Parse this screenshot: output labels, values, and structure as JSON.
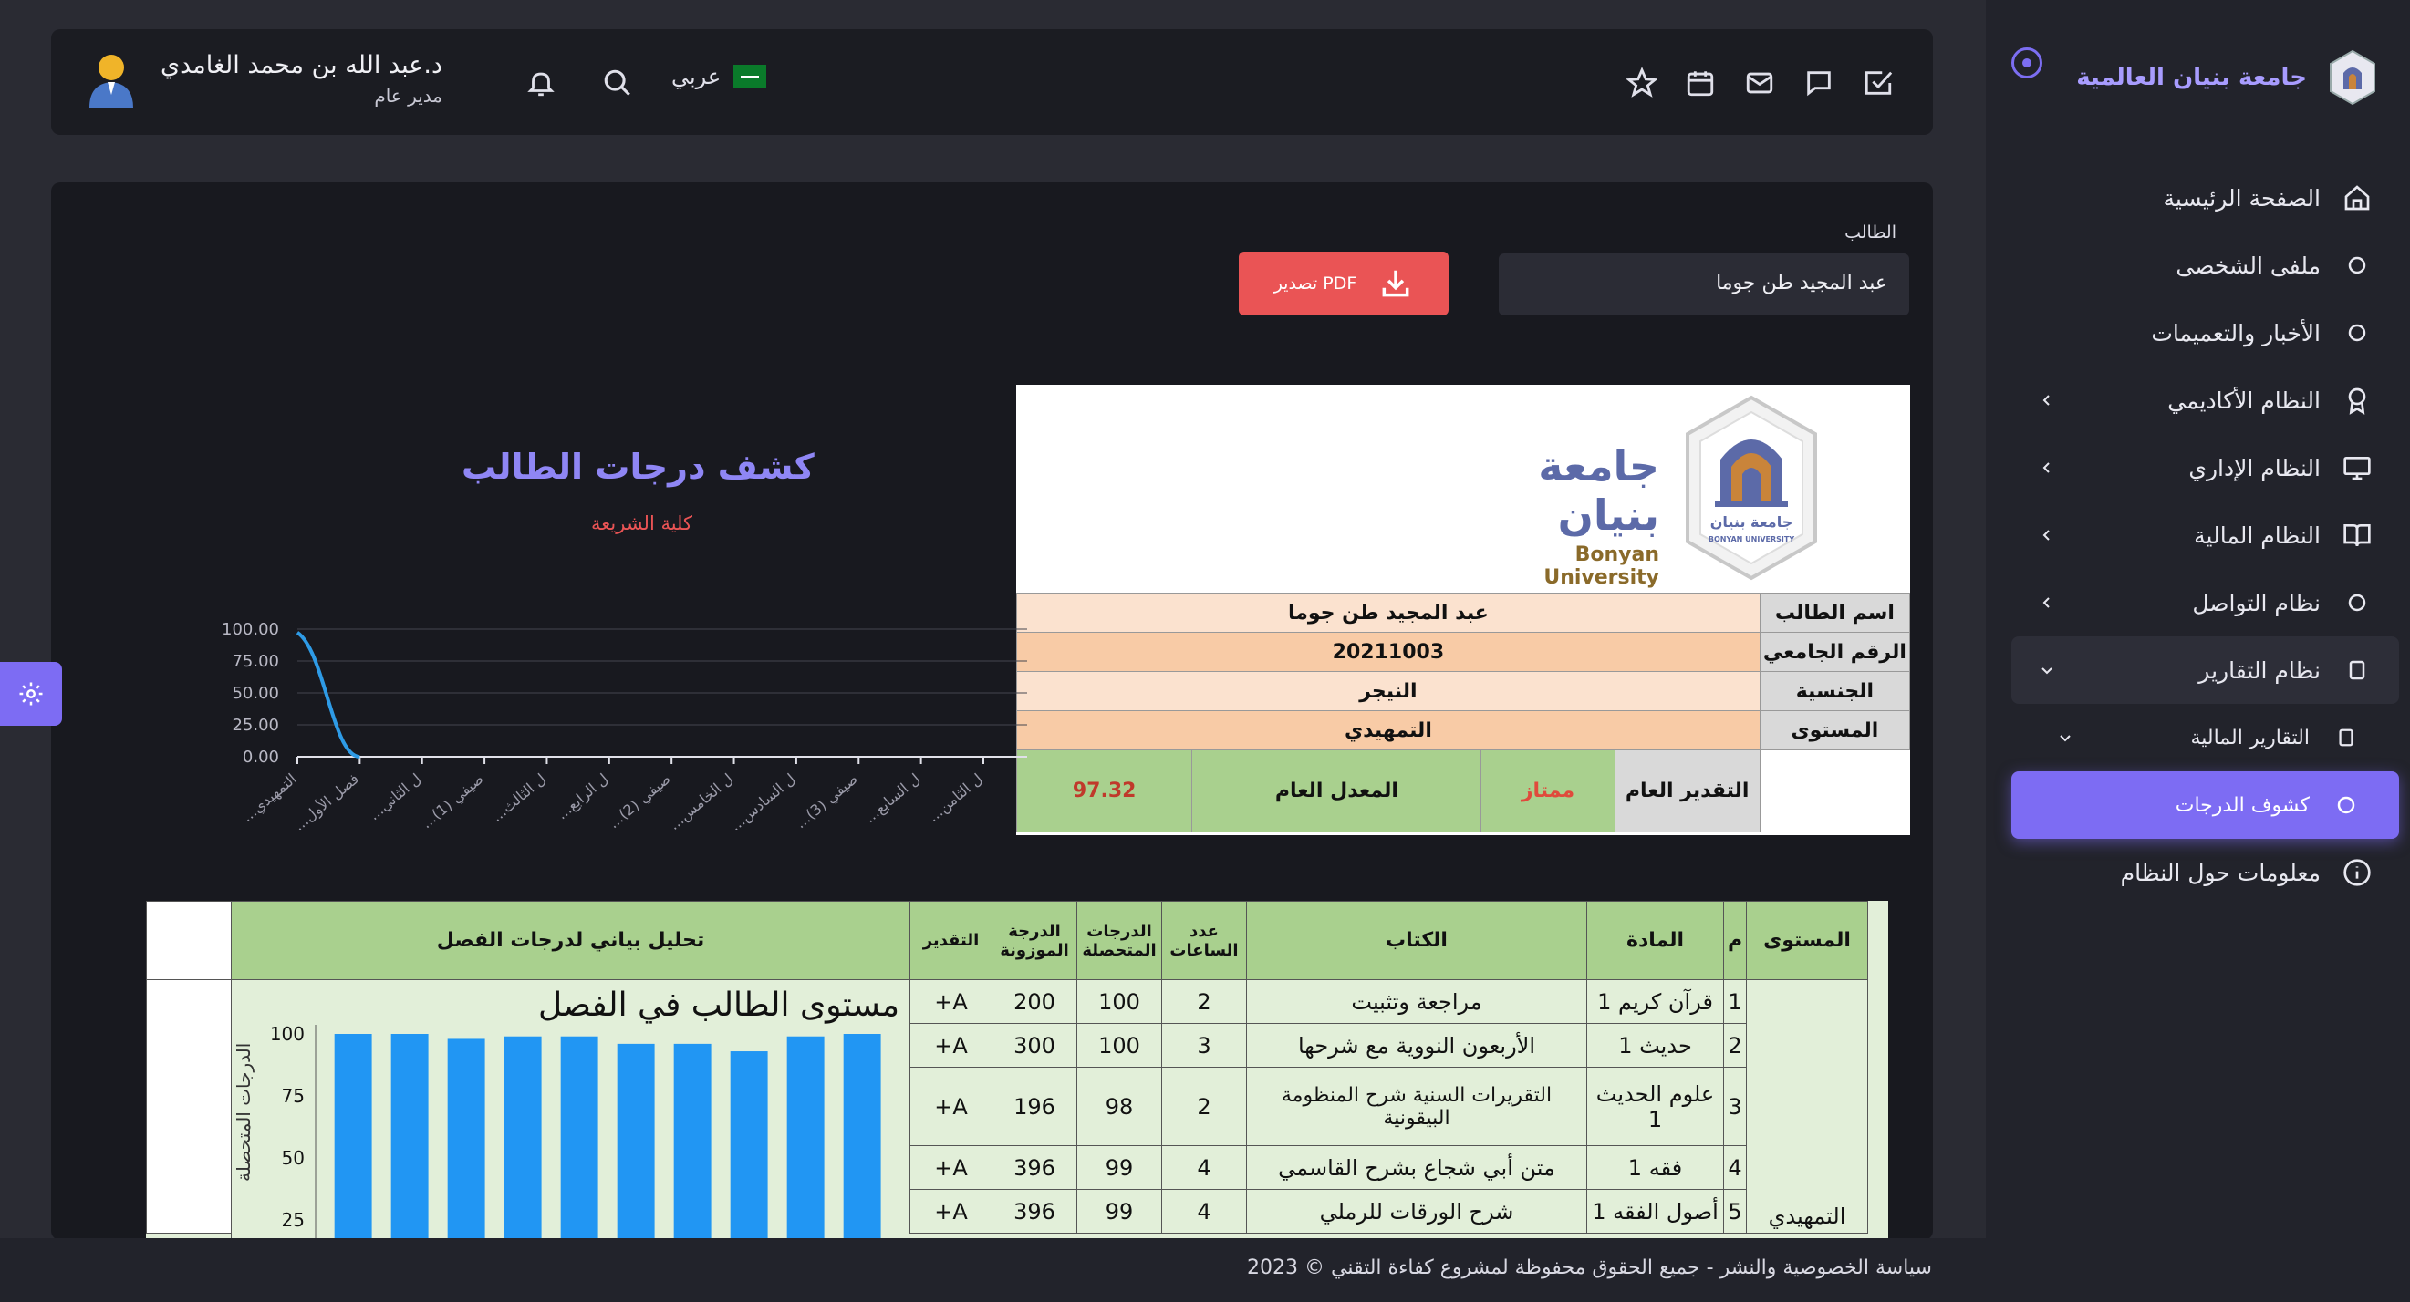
{
  "sidebar": {
    "brand": "جامعة بنيان العالمية",
    "items": [
      {
        "label": "الصفحة الرئيسية",
        "icon": "home-icon"
      },
      {
        "label": "ملفى الشخصى",
        "icon": "circle-icon"
      },
      {
        "label": "الأخبار والتعميمات",
        "icon": "circle-icon"
      },
      {
        "label": "النظام الأكاديمي",
        "icon": "award-icon"
      },
      {
        "label": "النظام الإداري",
        "icon": "monitor-icon"
      },
      {
        "label": "النظام المالية",
        "icon": "book-icon"
      },
      {
        "label": "نظام التواصل",
        "icon": "circle-icon"
      },
      {
        "label": "نظام التقارير",
        "icon": "square-icon"
      },
      {
        "label": "التقارير المالية",
        "icon": "square-icon"
      },
      {
        "label": "كشوف الدرجات",
        "icon": "circle-icon"
      },
      {
        "label": "معلومات حول النظام",
        "icon": "info-icon"
      }
    ]
  },
  "header": {
    "user_name": "د.عبد الله بن محمد الغامدي",
    "user_role": "مدير عام",
    "language": "عربي"
  },
  "main": {
    "student_label": "الطالب",
    "student_value": "عبد المجيد طن جوما",
    "pdf_label": "تصدير PDF"
  },
  "report": {
    "uni_ar": "جامعة بنيان",
    "uni_en": "Bonyan University",
    "logo_text": "جامعة بنيان",
    "logo_sub": "BONYAN UNIVERSITY",
    "rows": [
      {
        "label": "اسم الطالب",
        "value": "عبد المجيد طن جوما"
      },
      {
        "label": "الرقم الجامعي",
        "value": "20211003"
      },
      {
        "label": "الجنسية",
        "value": "النيجر"
      },
      {
        "label": "المستوى",
        "value": "التمهيدي"
      }
    ],
    "grade_label": "التقدير العام",
    "grade_value": "ممتاز",
    "gpa_label": "المعدل العام",
    "gpa_value": "97.32"
  },
  "line_chart": {
    "title": "كشف درجات الطالب",
    "subtitle": "كلية الشريعة",
    "chart_data": {
      "type": "line",
      "y_ticks": [
        "100.00",
        "75.00",
        "50.00",
        "25.00",
        "0.00"
      ],
      "ylim": [
        0,
        100
      ],
      "categories": [
        "...التمهيدي",
        "...فصل الأول",
        "...ل الثاني",
        "...صيفي (1)",
        "...ل الثالث",
        "...ل الرابع",
        "...صيفي (2)",
        "...ل الخامس",
        "...ل السادس",
        "...صيفي (3)",
        "...ل السابع",
        "...ل الثامن"
      ],
      "values": [
        97.32,
        0,
        0,
        0,
        0,
        0,
        0,
        0,
        0,
        0,
        0,
        0
      ],
      "color": "#2e9be6"
    }
  },
  "detail": {
    "headers": {
      "level": "المستوى",
      "no": "م",
      "subject": "المادة",
      "book": "الكتاب",
      "hours": "عدد الساعات",
      "obtained": "الدرجات المتحصلة",
      "weighted": "الدرجة الموزونة",
      "grade": "التقدير",
      "analysis": "تحليل بياني لدرجات الفصل"
    },
    "level_value": "التمهيدي",
    "rows": [
      {
        "no": "1",
        "subject": "قرآن كريم 1",
        "book": "مراجعة وتثبيت",
        "hours": "2",
        "obtained": "100",
        "weighted": "200",
        "grade": "A+"
      },
      {
        "no": "2",
        "subject": "حديث 1",
        "book": "الأربعون النووية مع شرحها",
        "hours": "3",
        "obtained": "100",
        "weighted": "300",
        "grade": "A+"
      },
      {
        "no": "3",
        "subject": "علوم الحديث 1",
        "book": "التقريرات السنية شرح المنظومة البيقونية",
        "hours": "2",
        "obtained": "98",
        "weighted": "196",
        "grade": "A+"
      },
      {
        "no": "4",
        "subject": "فقه 1",
        "book": "متن أبي شجاع بشرح القاسمي",
        "hours": "4",
        "obtained": "99",
        "weighted": "396",
        "grade": "A+"
      },
      {
        "no": "5",
        "subject": "أصول الفقه 1",
        "book": "شرح الورقات للرملي",
        "hours": "4",
        "obtained": "99",
        "weighted": "396",
        "grade": "A+"
      }
    ],
    "bar_chart": {
      "title": "مستوى الطالب في الفصل",
      "ylabel": "الدرجات المتحصلة",
      "chart_data": {
        "type": "bar",
        "y_ticks": [
          "100",
          "75",
          "50",
          "25"
        ],
        "ylim": [
          0,
          100
        ],
        "values": [
          100,
          100,
          98,
          99,
          99,
          96,
          96,
          93,
          99,
          100
        ],
        "color": "#2196f3"
      }
    }
  },
  "footer": {
    "text": "سياسة الخصوصية والنشر - جميع الحقوق محفوظة لمشروع كفاءة التقني © 2023"
  }
}
